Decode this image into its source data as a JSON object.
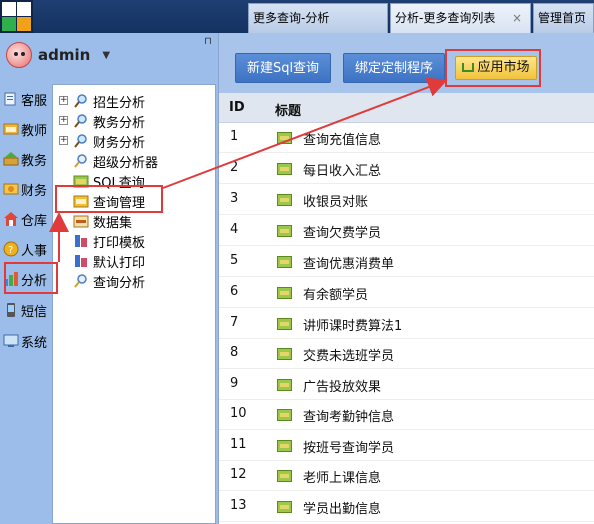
{
  "tabs": [
    {
      "label": "更多查询-分析"
    },
    {
      "label": "分析-更多查询列表",
      "close": "×"
    },
    {
      "label": "管理首页"
    }
  ],
  "user": {
    "name": "admin",
    "caret": "▼",
    "pin": "⊓"
  },
  "nav": [
    {
      "label": "客服",
      "icon": "service-icon"
    },
    {
      "label": "教师",
      "icon": "teacher-icon"
    },
    {
      "label": "教务",
      "icon": "academic-icon"
    },
    {
      "label": "财务",
      "icon": "finance-icon"
    },
    {
      "label": "仓库",
      "icon": "warehouse-icon"
    },
    {
      "label": "人事",
      "icon": "hr-icon"
    },
    {
      "label": "分析",
      "icon": "analysis-icon"
    },
    {
      "label": "短信",
      "icon": "sms-icon"
    },
    {
      "label": "系统",
      "icon": "system-icon"
    }
  ],
  "tree": [
    {
      "label": "招生分析",
      "expand": "+"
    },
    {
      "label": "教务分析",
      "expand": "+"
    },
    {
      "label": "财务分析",
      "expand": "+"
    },
    {
      "label": "超级分析器"
    },
    {
      "label": "SQL查询"
    },
    {
      "label": "查询管理"
    },
    {
      "label": "数据集"
    },
    {
      "label": "打印模板"
    },
    {
      "label": "默认打印"
    },
    {
      "label": "查询分析"
    }
  ],
  "toolbar": {
    "new_sql": "新建Sql查询",
    "bind_program": "绑定定制程序",
    "app_market": "应用市场"
  },
  "list": {
    "columns": {
      "id": "ID",
      "title": "标题"
    },
    "rows": [
      {
        "id": "1",
        "title": "查询充值信息"
      },
      {
        "id": "2",
        "title": "每日收入汇总"
      },
      {
        "id": "3",
        "title": "收银员对账"
      },
      {
        "id": "4",
        "title": "查询欠费学员"
      },
      {
        "id": "5",
        "title": "查询优惠消费单"
      },
      {
        "id": "6",
        "title": "有余额学员"
      },
      {
        "id": "7",
        "title": "讲师课时费算法1"
      },
      {
        "id": "8",
        "title": "交费未选班学员"
      },
      {
        "id": "9",
        "title": "广告投放效果"
      },
      {
        "id": "10",
        "title": "查询考勤钟信息"
      },
      {
        "id": "11",
        "title": "按班号查询学员"
      },
      {
        "id": "12",
        "title": "老师上课信息"
      },
      {
        "id": "13",
        "title": "学员出勤信息"
      }
    ]
  },
  "colors": {
    "topbar": "#143261",
    "left_pane": "#9cbde9",
    "button_blue": "#4a80cf",
    "market_button": "#f2c23c",
    "annotation_red": "#e03a3a"
  }
}
